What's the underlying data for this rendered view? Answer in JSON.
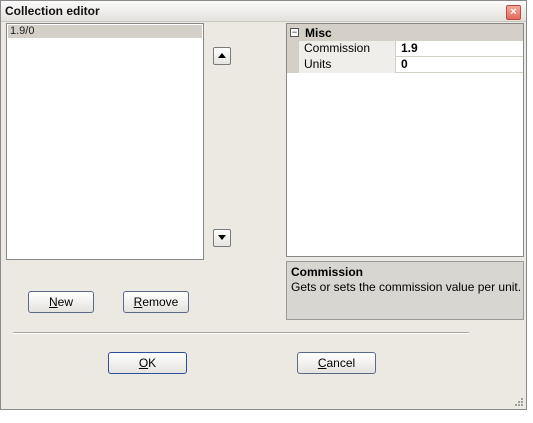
{
  "window": {
    "title": "Collection editor",
    "close_glyph": "×"
  },
  "list": {
    "items": [
      "1.9/0"
    ]
  },
  "property_grid": {
    "category": "Misc",
    "rows": [
      {
        "name": "Commission",
        "value": "1.9"
      },
      {
        "name": "Units",
        "value": "0"
      }
    ]
  },
  "help": {
    "title": "Commission",
    "description": "Gets or sets the commission value per unit."
  },
  "buttons": {
    "new": {
      "mnemonic": "N",
      "rest": "ew"
    },
    "remove": {
      "mnemonic": "R",
      "rest": "emove"
    },
    "ok": {
      "mnemonic": "O",
      "rest": "K"
    },
    "cancel": {
      "mnemonic": "C",
      "rest": "ancel"
    }
  },
  "icons": {
    "up": "arrow-up-icon",
    "down": "arrow-down-icon",
    "close": "close-icon",
    "grip": "resize-grip-icon"
  },
  "colors": {
    "dialog_bg": "#ece9e3",
    "selection_bg": "#d4d0c8",
    "close_red": "#e36a5e",
    "button_border": "#5a6b8a"
  }
}
